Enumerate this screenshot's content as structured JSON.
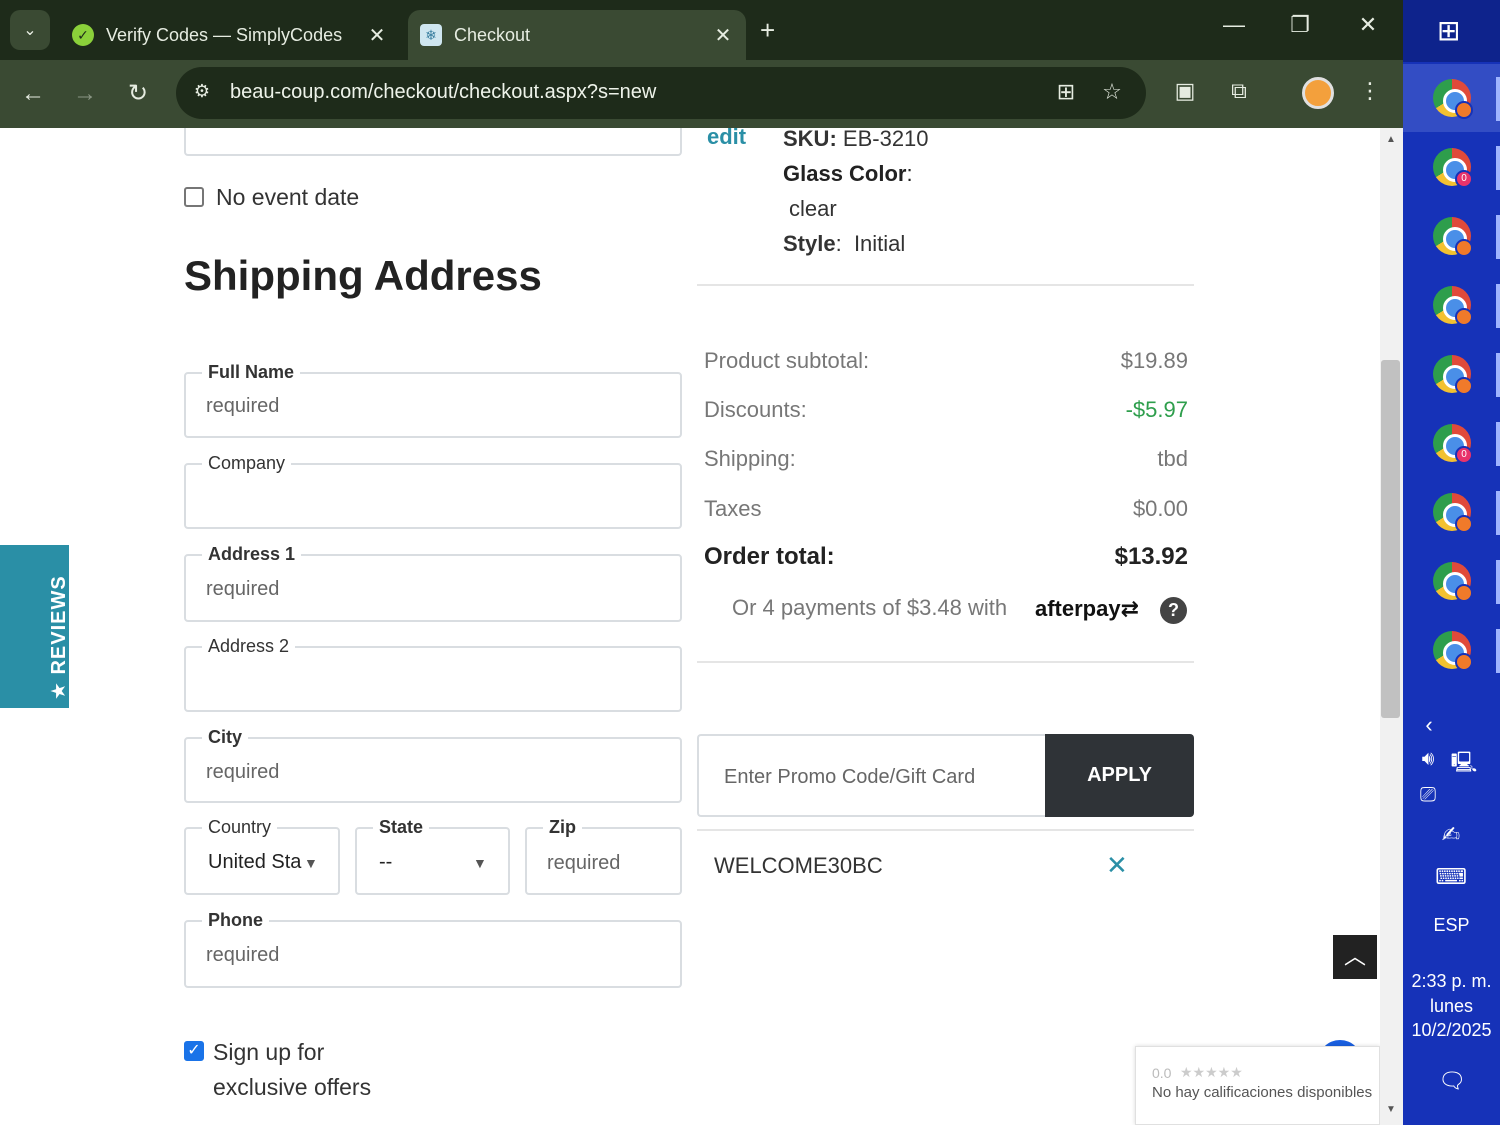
{
  "browser": {
    "tabs": [
      {
        "title": "Verify Codes — SimplyCodes",
        "active": false
      },
      {
        "title": "Checkout",
        "active": true
      }
    ],
    "url": "beau-coup.com/checkout/checkout.aspx?s=new"
  },
  "order_item": {
    "edit_label": "edit",
    "sku_label": "SKU:",
    "sku_value": "EB-3210",
    "glass_label": "Glass Color",
    "glass_value": "clear",
    "style_label": "Style",
    "style_value": "Initial"
  },
  "event": {
    "no_event_date_label": "No event date"
  },
  "shipping": {
    "heading": "Shipping Address",
    "full_name": {
      "label": "Full Name",
      "placeholder": "required"
    },
    "company": {
      "label": "Company",
      "placeholder": ""
    },
    "address1": {
      "label": "Address 1",
      "placeholder": "required"
    },
    "address2": {
      "label": "Address 2",
      "placeholder": ""
    },
    "city": {
      "label": "City",
      "placeholder": "required"
    },
    "country": {
      "label": "Country",
      "value": "United Sta"
    },
    "state": {
      "label": "State",
      "value": "--"
    },
    "zip": {
      "label": "Zip",
      "placeholder": "required"
    },
    "phone": {
      "label": "Phone",
      "placeholder": "required"
    }
  },
  "signup": {
    "line1": "Sign up for",
    "line2": "exclusive offers",
    "checked": true
  },
  "summary": {
    "subtotal_label": "Product subtotal:",
    "subtotal_value": "$19.89",
    "discounts_label": "Discounts:",
    "discounts_value": "-$5.97",
    "shipping_label": "Shipping:",
    "shipping_value": "tbd",
    "taxes_label": "Taxes",
    "taxes_value": "$0.00",
    "total_label": "Order total:",
    "total_value": "$13.92",
    "afterpay_text": "Or 4 payments of $3.48 with",
    "afterpay_brand": "afterpay",
    "help_glyph": "?"
  },
  "promo": {
    "placeholder": "Enter Promo Code/Gift Card",
    "apply_label": "APPLY",
    "applied_code": "WELCOME30BC"
  },
  "reviews_tab": {
    "label": "★ REVIEWS"
  },
  "rating_widget": {
    "score": "0.0",
    "stars": "★★★★★",
    "text": "No hay calificaciones disponibles"
  },
  "taskbar": {
    "language": "ESP",
    "time": "2:33 p. m.",
    "day": "lunes",
    "date": "10/2/2025",
    "badges": [
      "",
      "0",
      "",
      "",
      "",
      "0",
      "",
      "",
      ""
    ]
  },
  "colors": {
    "discount": "#2e9e4c",
    "accent": "#2a8fa6",
    "apply_bg": "#2f3337",
    "taskbar": "#1632b8"
  }
}
